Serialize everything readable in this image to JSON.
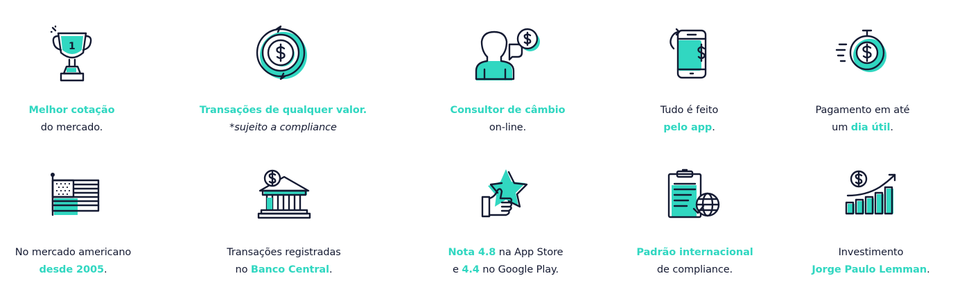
{
  "colors": {
    "accent": "#31d7c1",
    "text": "#141a32",
    "background": "#ffffff"
  },
  "features": [
    {
      "icon": "trophy-icon",
      "digit": "1",
      "line1": [
        {
          "t": "Melhor cotação",
          "hl": true
        }
      ],
      "line2": [
        {
          "t": "do mercado.",
          "hl": false
        }
      ]
    },
    {
      "icon": "currency-exchange-icon",
      "line1": [
        {
          "t": "Transações de qualquer valor.",
          "hl": true
        }
      ],
      "line2": [
        {
          "t": "*sujeito a compliance",
          "hl": false,
          "italic": true
        }
      ]
    },
    {
      "icon": "consultant-chat-icon",
      "line1": [
        {
          "t": "Consultor de câmbio",
          "hl": true
        }
      ],
      "line2": [
        {
          "t": "on-line.",
          "hl": false
        }
      ]
    },
    {
      "icon": "mobile-app-icon",
      "line1": [
        {
          "t": "Tudo é feito",
          "hl": false
        }
      ],
      "line2": [
        {
          "t": "pelo app",
          "hl": true
        },
        {
          "t": ".",
          "hl": false
        }
      ]
    },
    {
      "icon": "stopwatch-dollar-icon",
      "line1": [
        {
          "t": "Pagamento em até",
          "hl": false
        }
      ],
      "line2": [
        {
          "t": "um ",
          "hl": false
        },
        {
          "t": "dia útil",
          "hl": true
        },
        {
          "t": ".",
          "hl": false
        }
      ]
    },
    {
      "icon": "us-flag-icon",
      "line1": [
        {
          "t": "No mercado americano",
          "hl": false
        }
      ],
      "line2": [
        {
          "t": "desde 2005",
          "hl": true
        },
        {
          "t": ".",
          "hl": false
        }
      ]
    },
    {
      "icon": "bank-icon",
      "line1": [
        {
          "t": "Transações registradas",
          "hl": false
        }
      ],
      "line2": [
        {
          "t": "no ",
          "hl": false
        },
        {
          "t": "Banco Central",
          "hl": true
        },
        {
          "t": ".",
          "hl": false
        }
      ]
    },
    {
      "icon": "thumbs-up-star-icon",
      "line1": [
        {
          "t": "Nota 4.8",
          "hl": true
        },
        {
          "t": " na App Store",
          "hl": false
        }
      ],
      "line2": [
        {
          "t": "e ",
          "hl": false
        },
        {
          "t": "4.4",
          "hl": true
        },
        {
          "t": " no Google Play.",
          "hl": false
        }
      ]
    },
    {
      "icon": "compliance-clipboard-globe-icon",
      "line1": [
        {
          "t": "Padrão internacional",
          "hl": true
        }
      ],
      "line2": [
        {
          "t": "de compliance.",
          "hl": false
        }
      ]
    },
    {
      "icon": "investment-growth-icon",
      "line1": [
        {
          "t": "Investimento",
          "hl": false
        }
      ],
      "line2": [
        {
          "t": "Jorge Paulo Lemman",
          "hl": true
        },
        {
          "t": ".",
          "hl": false
        }
      ]
    }
  ]
}
